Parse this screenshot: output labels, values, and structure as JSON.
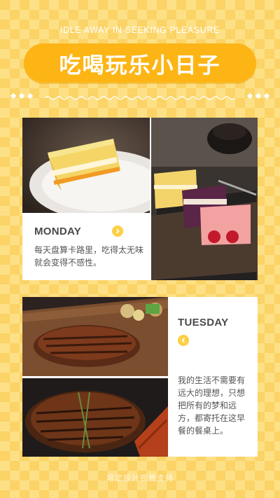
{
  "header": {
    "tagline": "IDLE AWAY IN SEEKING PLEASURE",
    "title": "吃喝玩乐小日子"
  },
  "cards": [
    {
      "day": "MONDAY",
      "text": "每天盘算卡路里，吃得太无味就会变得不感性。"
    },
    {
      "day": "TUESDAY",
      "text": "我的生活不需要有远大的理想，只想把所有的梦和远方，都寄托在这早餐的餐桌上。"
    }
  ],
  "footer": {
    "text": "培定設計視覺支持"
  },
  "colors": {
    "background": "#fbd366",
    "accent": "#fdb515",
    "card": "#ffffff"
  },
  "icons": [
    "chevron-right-icon",
    "chevron-left-icon"
  ]
}
